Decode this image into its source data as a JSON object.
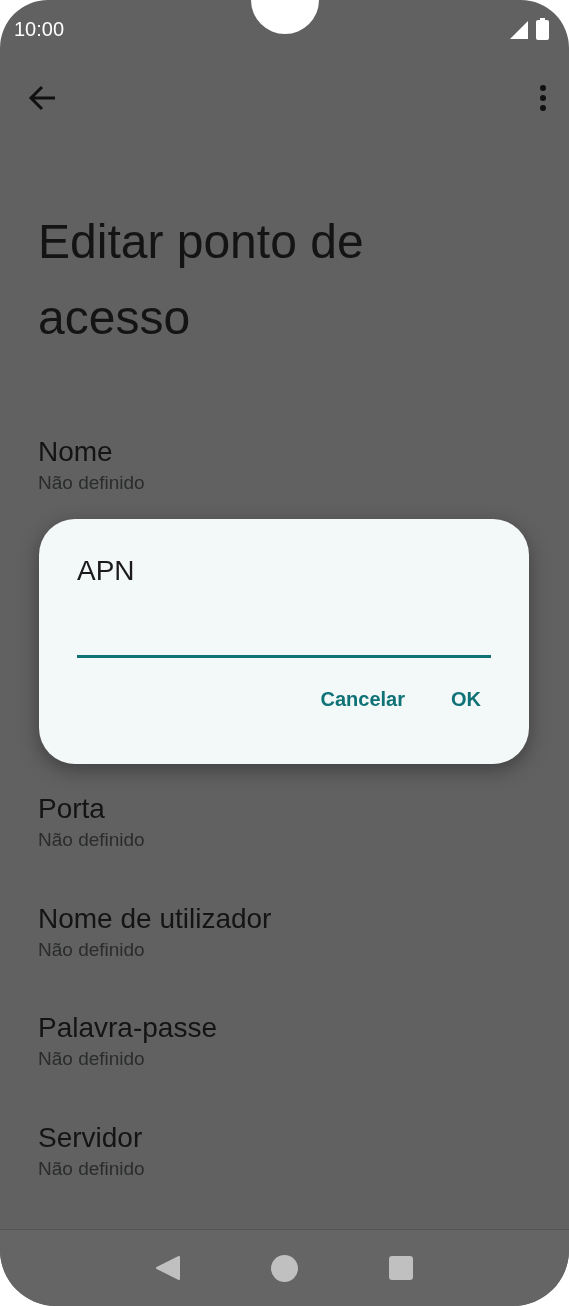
{
  "status_bar": {
    "time": "10:00"
  },
  "page_title": "Editar ponto de acesso",
  "settings": [
    {
      "title": "Nome",
      "value": "Não definido"
    },
    {
      "title": "Porta",
      "value": "Não definido"
    },
    {
      "title": "Nome de utilizador",
      "value": "Não definido"
    },
    {
      "title": "Palavra-passe",
      "value": "Não definido"
    },
    {
      "title": "Servidor",
      "value": "Não definido"
    }
  ],
  "dialog": {
    "title": "APN",
    "buttons": [
      "Cancelar",
      "OK"
    ]
  }
}
